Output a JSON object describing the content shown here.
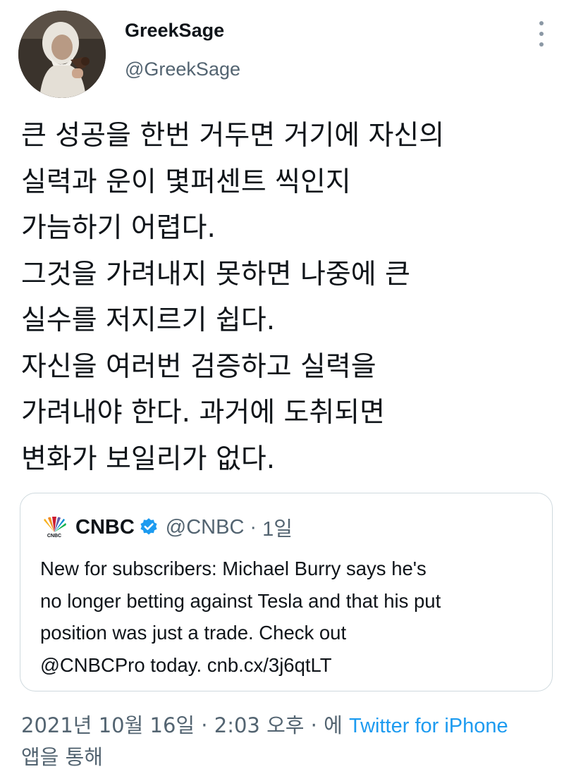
{
  "author": {
    "display_name": "GreekSage",
    "handle": "@GreekSage",
    "avatar_icon": "wizard-avatar"
  },
  "tweet": {
    "lines": [
      "큰 성공을 한번 거두면 거기에 자신의",
      "실력과 운이 몇퍼센트 씩인지",
      "가늠하기 어렵다.",
      "그것을 가려내지 못하면 나중에 큰",
      "실수를 저지르기 쉽다.",
      "자신을 여러번 검증하고 실력을",
      "가려내야 한다. 과거에 도취되면",
      "변화가 보일리가 없다."
    ]
  },
  "quoted_tweet": {
    "name": "CNBC",
    "handle": "@CNBC",
    "separator": "·",
    "time": "1일",
    "verified": true,
    "logo_icon": "cnbc-peacock-logo",
    "lines": [
      "New for subscribers: Michael Burry says he's",
      "no longer betting against Tesla and that his put",
      "position was just a trade. Check out",
      "@CNBCPro today. cnb.cx/3j6qtLT"
    ]
  },
  "footer": {
    "timestamp": "2021년 10월 16일 · 2:03 오후 · 에",
    "source": "Twitter for iPhone",
    "suffix": "앱을 통해"
  },
  "colors": {
    "text": "#0f1419",
    "secondary": "#536471",
    "link": "#1d9bf0",
    "border": "#cfd9de",
    "verified": "#1d9bf0"
  },
  "icons": {
    "more": "more-vertical-icon",
    "verified": "verified-badge-icon"
  }
}
